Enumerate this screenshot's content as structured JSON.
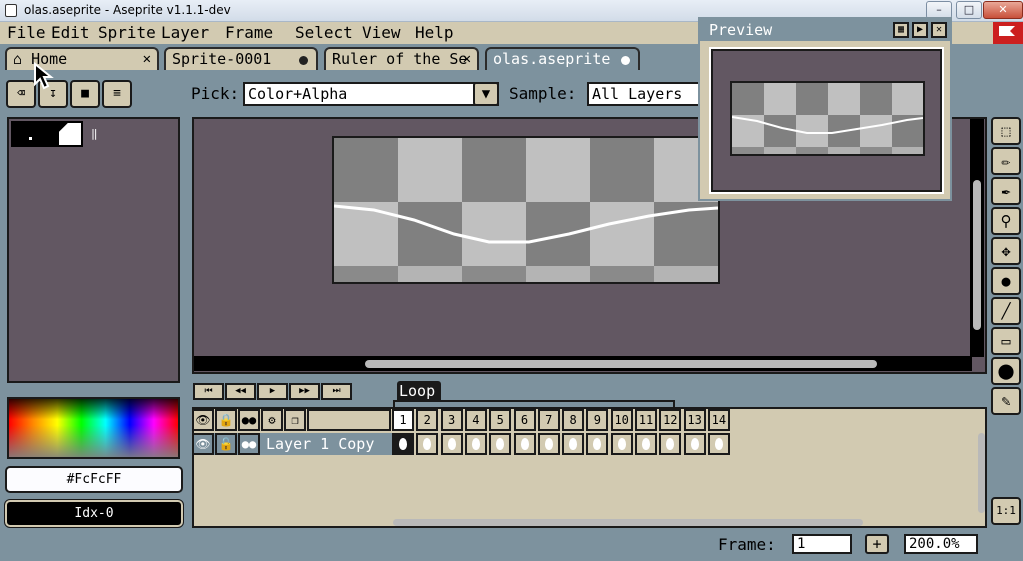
{
  "window": {
    "title": "olas.aseprite - Aseprite v1.1.1-dev",
    "minimize": "–",
    "maximize": "□",
    "close": "✕"
  },
  "menu": [
    {
      "label": "File"
    },
    {
      "label": "Edit"
    },
    {
      "label": "Sprite"
    },
    {
      "label": "Layer"
    },
    {
      "label": "Frame"
    },
    {
      "label": "Select"
    },
    {
      "label": "View"
    },
    {
      "label": "Help"
    }
  ],
  "tabs": [
    {
      "label": "Home",
      "close": "✕"
    },
    {
      "label": "Sprite-0001"
    },
    {
      "label": "Ruler of the Se",
      "close": "✕"
    },
    {
      "label": "olas.aseprite"
    }
  ],
  "context": {
    "pick_label": "Pick:",
    "pick_value": "Color+Alpha",
    "sample_label": "Sample:",
    "sample_value": "All Layers"
  },
  "colors": {
    "fg_label": "#FcFcFF",
    "bg_label": "Idx-0",
    "editor_bg": "#625762",
    "panel_bg": "#d2cab1",
    "accent": "#7d929e"
  },
  "preview": {
    "title": "Preview"
  },
  "tools": [
    {
      "icon": "rectangular-marquee-icon"
    },
    {
      "icon": "pencil-icon"
    },
    {
      "icon": "eyedropper-icon"
    },
    {
      "icon": "zoom-icon"
    },
    {
      "icon": "move-icon"
    },
    {
      "icon": "paint-bucket-icon"
    },
    {
      "icon": "line-icon"
    },
    {
      "icon": "rectangle-icon"
    },
    {
      "icon": "blur-icon"
    },
    {
      "icon": "spray-icon"
    }
  ],
  "zoom_button": "1:1",
  "timeline": {
    "tag_name": "Loop",
    "layer_name": "Layer 1 Copy",
    "frames": [
      "1",
      "2",
      "3",
      "4",
      "5",
      "6",
      "7",
      "8",
      "9",
      "10",
      "11",
      "12",
      "13",
      "14"
    ],
    "active_frame": "1"
  },
  "status": {
    "frame_label": "Frame:",
    "frame_value": "1",
    "add_label": "+",
    "zoom_value": "200.0%"
  }
}
